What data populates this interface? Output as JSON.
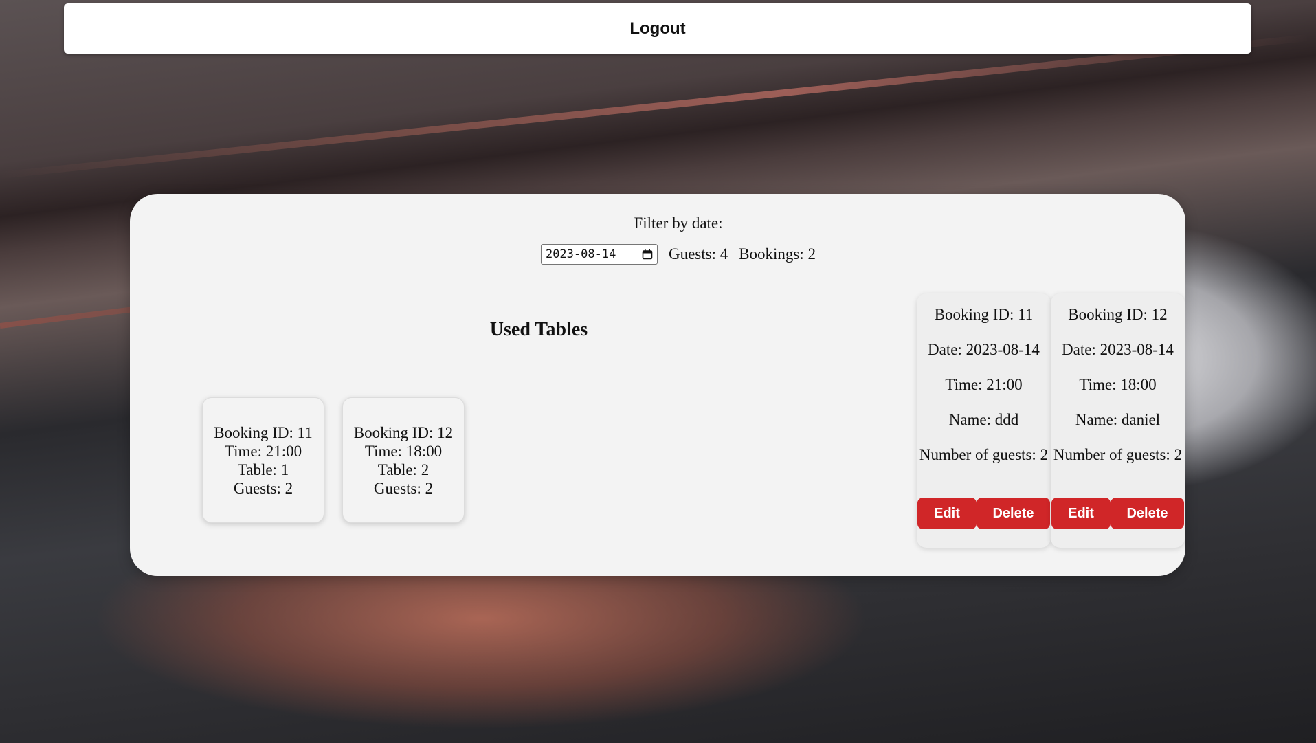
{
  "header": {
    "logout_label": "Logout"
  },
  "filter": {
    "label": "Filter by date:",
    "date_value": "2023-08-14",
    "guests_text": "Guests: 4",
    "bookings_text": "Bookings: 2"
  },
  "used_tables": {
    "title": "Used Tables",
    "cards": [
      {
        "booking_id": "Booking ID: 11",
        "time": "Time: 21:00",
        "table": "Table: 1",
        "guests": "Guests: 2"
      },
      {
        "booking_id": "Booking ID: 12",
        "time": "Time: 18:00",
        "table": "Table: 2",
        "guests": "Guests: 2"
      }
    ]
  },
  "bookings": [
    {
      "booking_id": "Booking ID: 11",
      "date": "Date: 2023-08-14",
      "time": "Time: 21:00",
      "name": "Name: ddd",
      "guests": "Number of guests: 2",
      "edit_label": "Edit",
      "delete_label": "Delete"
    },
    {
      "booking_id": "Booking ID: 12",
      "date": "Date: 2023-08-14",
      "time": "Time: 18:00",
      "name": "Name: daniel",
      "guests": "Number of guests: 2",
      "edit_label": "Edit",
      "delete_label": "Delete"
    }
  ],
  "colors": {
    "button_red": "#d02628",
    "panel_bg": "#f3f3f3"
  },
  "icons": {
    "date_picker": "calendar-icon"
  }
}
